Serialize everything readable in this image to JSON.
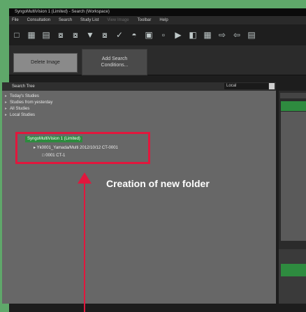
{
  "window": {
    "title": "SyngoMultiVision 1 (Limited) - Search (Workspace)"
  },
  "menu": {
    "items": [
      "File",
      "Consultation",
      "Search",
      "Study List",
      "View Image",
      "Toolbar",
      "Help"
    ],
    "dim_index": 4
  },
  "toolbar": {
    "icons": [
      "new-icon",
      "patient-icon",
      "study-icon",
      "filter-icon",
      "filter-icon",
      "filter-tree-icon",
      "filter-icon",
      "filter-check-icon",
      "series-icon",
      "image-icon",
      "image-edit-icon",
      "image-send-icon",
      "folder-icon",
      "image-view-icon",
      "export-icon",
      "import-icon",
      "save-icon"
    ]
  },
  "actions": {
    "delete_label": "Delete Image",
    "add_search_label_line1": "Add Search",
    "add_search_label_line2": "Conditions..."
  },
  "tree_panel": {
    "header": "Search Tree",
    "dropdown_value": "Local",
    "items": [
      {
        "label": "Today's Studies"
      },
      {
        "label": "Studies from yesterday"
      },
      {
        "label": "All Studies"
      },
      {
        "label": "Local Studies"
      }
    ],
    "new_folder_label": "SyngoMultiVision 1 (Limited)",
    "sub_item_label": "Yk0001_Yamada/Multi 2012/10/12 CT-0001",
    "sub_sub_item_label": "0001 CT-1"
  },
  "annotation": {
    "text": "Creation of new folder"
  },
  "colors": {
    "frame_bg": "#5fa86a",
    "highlight_red": "#e1173d",
    "selection_green": "#2e8b3f",
    "panel_gray": "#676767"
  }
}
